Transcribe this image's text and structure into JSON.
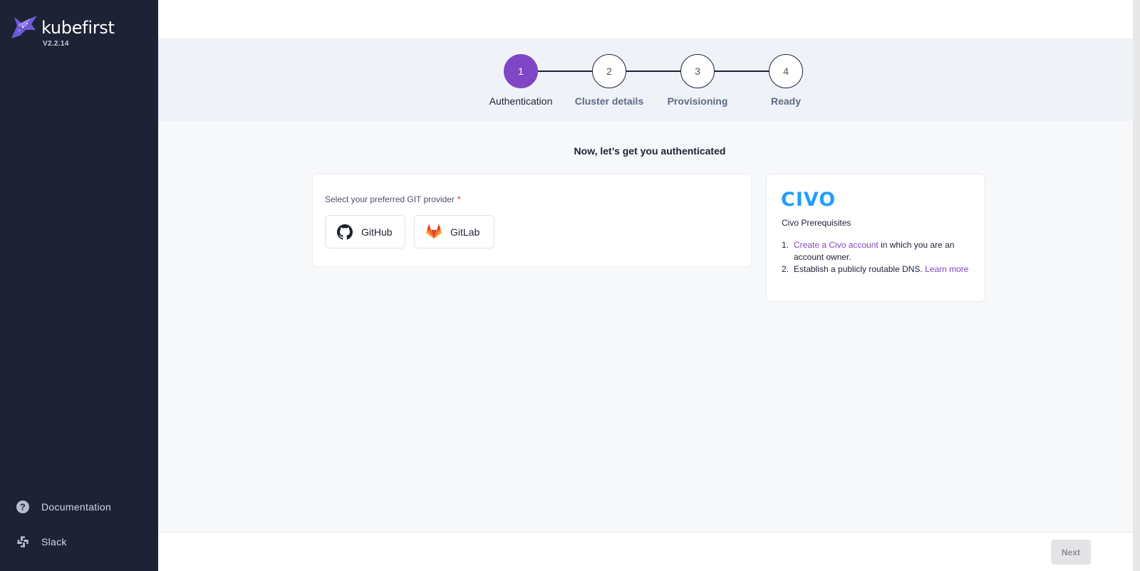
{
  "sidebar": {
    "brand": "kubefirst",
    "version": "V2.2.14",
    "links": [
      {
        "label": "Documentation",
        "icon": "help-circle-icon"
      },
      {
        "label": "Slack",
        "icon": "slack-icon"
      }
    ]
  },
  "stepper": {
    "steps": [
      {
        "number": "1",
        "label": "Authentication",
        "active": true
      },
      {
        "number": "2",
        "label": "Cluster details",
        "active": false
      },
      {
        "number": "3",
        "label": "Provisioning",
        "active": false
      },
      {
        "number": "4",
        "label": "Ready",
        "active": false
      }
    ]
  },
  "main": {
    "heading": "Now, let’s get you authenticated",
    "provider_label": "Select your preferred GIT provider",
    "required_mark": "*",
    "providers": [
      {
        "label": "GitHub",
        "icon": "github-icon"
      },
      {
        "label": "GitLab",
        "icon": "gitlab-icon"
      }
    ]
  },
  "info": {
    "logo_text": "CIVO",
    "title": "Civo Prerequisites",
    "items": [
      {
        "num": "1.",
        "link": "Create a Civo account",
        "text": " in which you are an account owner."
      },
      {
        "num": "2.",
        "text": "Establish a publicly routable DNS. ",
        "link": "Learn more"
      }
    ]
  },
  "footer": {
    "next_label": "Next"
  },
  "colors": {
    "sidebar_bg": "#1e2235",
    "accent": "#8146c5",
    "civo_blue": "#239dff"
  }
}
